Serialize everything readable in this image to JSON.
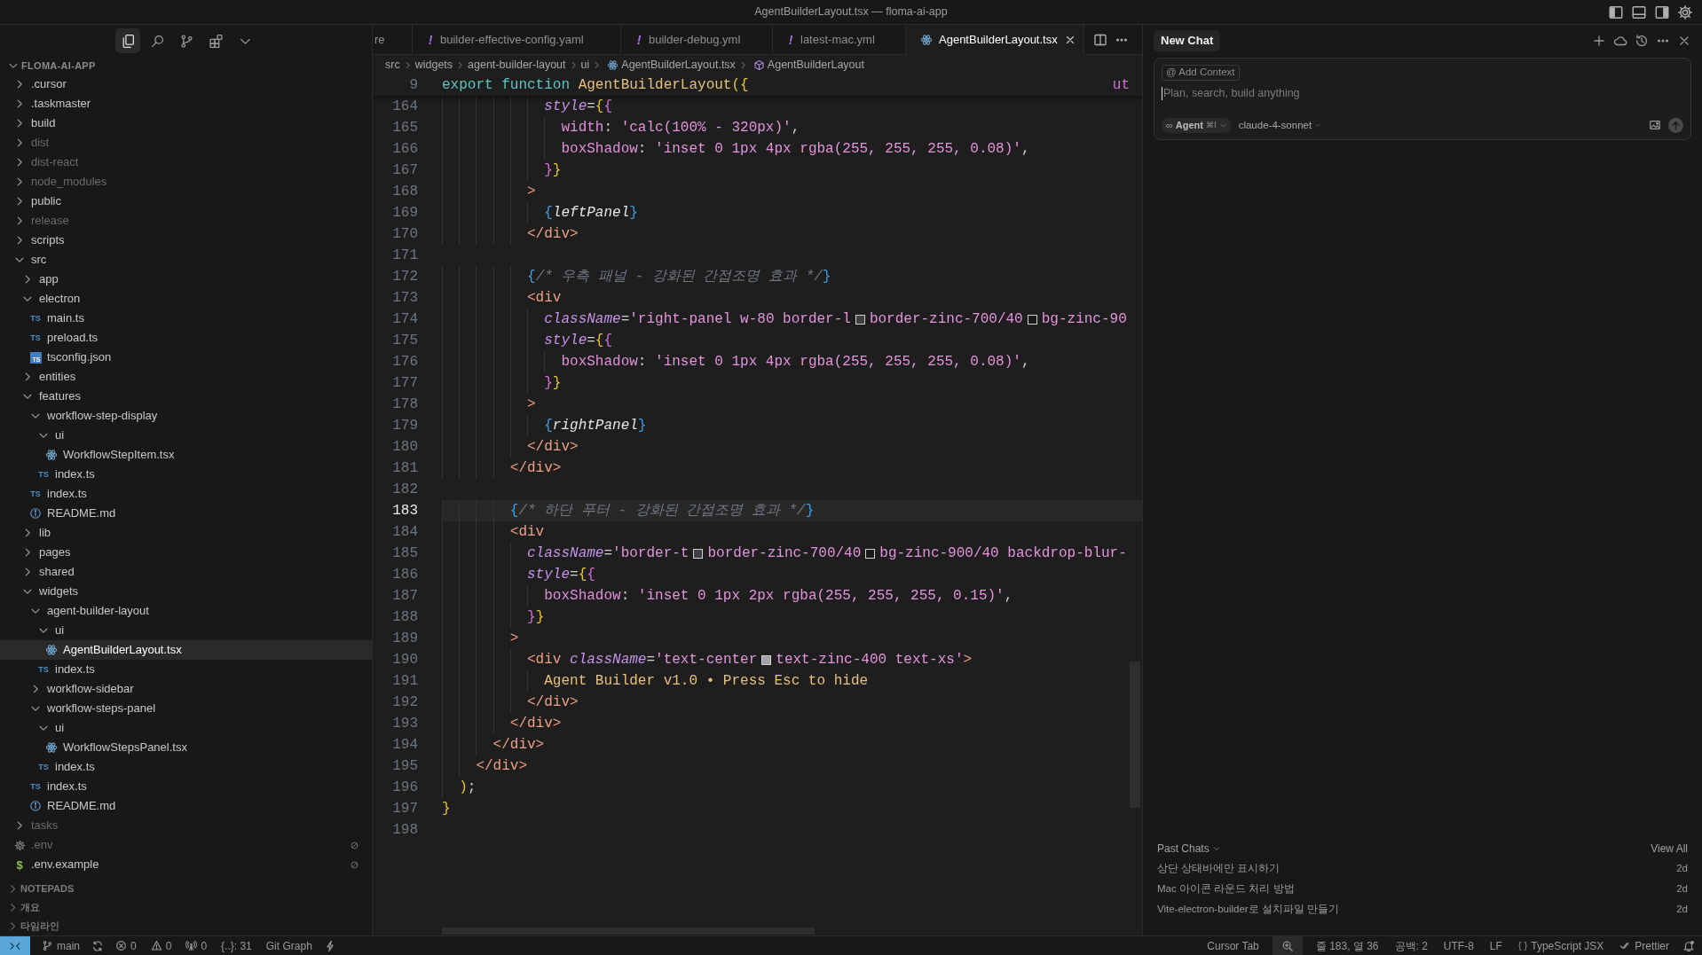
{
  "window": {
    "title": "AgentBuilderLayout.tsx — floma-ai-app"
  },
  "title_bar_icons": [
    {
      "kind": "layout-left"
    },
    {
      "kind": "layout-bottom"
    },
    {
      "kind": "layout-right"
    },
    {
      "kind": "settings"
    }
  ],
  "activity_bar": [
    {
      "kind": "files",
      "selected": true
    },
    {
      "kind": "search",
      "selected": false
    },
    {
      "kind": "source-control",
      "selected": false
    },
    {
      "kind": "extensions",
      "selected": false
    },
    {
      "kind": "more",
      "selected": false
    }
  ],
  "explorer": {
    "title": "FLOMA-AI-APP",
    "expanded": true,
    "items": [
      {
        "label": ".cursor",
        "kind": "folder",
        "expanded": false,
        "ignored": false,
        "excluded": false,
        "selected": false
      },
      {
        "label": ".taskmaster",
        "kind": "folder",
        "expanded": false,
        "ignored": false,
        "excluded": false,
        "selected": false
      },
      {
        "label": "build",
        "kind": "folder",
        "expanded": false,
        "ignored": false,
        "excluded": false,
        "selected": false
      },
      {
        "label": "dist",
        "kind": "folder",
        "expanded": false,
        "ignored": true,
        "excluded": false,
        "selected": false
      },
      {
        "label": "dist-react",
        "kind": "folder",
        "expanded": false,
        "ignored": true,
        "excluded": false,
        "selected": false
      },
      {
        "label": "node_modules",
        "kind": "folder",
        "expanded": false,
        "ignored": true,
        "excluded": false,
        "selected": false
      },
      {
        "label": "public",
        "kind": "folder",
        "expanded": false,
        "ignored": false,
        "excluded": false,
        "selected": false
      },
      {
        "label": "release",
        "kind": "folder",
        "expanded": false,
        "ignored": true,
        "excluded": false,
        "selected": false
      },
      {
        "label": "scripts",
        "kind": "folder",
        "expanded": false,
        "ignored": false,
        "excluded": false,
        "selected": false
      },
      {
        "label": "src",
        "kind": "folder",
        "expanded": true,
        "ignored": false,
        "excluded": false,
        "selected": false,
        "children": [
          {
            "label": "app",
            "kind": "folder",
            "expanded": false,
            "ignored": false,
            "excluded": false,
            "selected": false
          },
          {
            "label": "electron",
            "kind": "folder",
            "expanded": true,
            "ignored": false,
            "excluded": false,
            "selected": false,
            "children": [
              {
                "label": "main.ts",
                "kind": "ts",
                "icon_text": "TS",
                "ignored": false,
                "excluded": false,
                "selected": false
              },
              {
                "label": "preload.ts",
                "kind": "ts",
                "icon_text": "TS",
                "ignored": false,
                "excluded": false,
                "selected": false
              },
              {
                "label": "tsconfig.json",
                "kind": "tsconfig",
                "icon_text": "TS",
                "ignored": false,
                "excluded": false,
                "selected": false
              }
            ]
          },
          {
            "label": "entities",
            "kind": "folder",
            "expanded": false,
            "ignored": false,
            "excluded": false,
            "selected": false
          },
          {
            "label": "features",
            "kind": "folder",
            "expanded": true,
            "ignored": false,
            "excluded": false,
            "selected": false,
            "children": [
              {
                "label": "workflow-step-display",
                "kind": "folder",
                "expanded": true,
                "ignored": false,
                "excluded": false,
                "selected": false,
                "children": [
                  {
                    "label": "ui",
                    "kind": "folder",
                    "expanded": true,
                    "ignored": false,
                    "excluded": false,
                    "selected": false,
                    "children": [
                      {
                        "label": "WorkflowStepItem.tsx",
                        "kind": "react",
                        "ignored": false,
                        "excluded": false,
                        "selected": false
                      }
                    ]
                  },
                  {
                    "label": "index.ts",
                    "kind": "ts",
                    "icon_text": "TS",
                    "ignored": false,
                    "excluded": false,
                    "selected": false
                  }
                ]
              },
              {
                "label": "index.ts",
                "kind": "ts",
                "icon_text": "TS",
                "ignored": false,
                "excluded": false,
                "selected": false
              },
              {
                "label": "README.md",
                "kind": "info",
                "ignored": false,
                "excluded": false,
                "selected": false
              }
            ]
          },
          {
            "label": "lib",
            "kind": "folder",
            "expanded": false,
            "ignored": false,
            "excluded": false,
            "selected": false
          },
          {
            "label": "pages",
            "kind": "folder",
            "expanded": false,
            "ignored": false,
            "excluded": false,
            "selected": false
          },
          {
            "label": "shared",
            "kind": "folder",
            "expanded": false,
            "ignored": false,
            "excluded": false,
            "selected": false
          },
          {
            "label": "widgets",
            "kind": "folder",
            "expanded": true,
            "ignored": false,
            "excluded": false,
            "selected": false,
            "children": [
              {
                "label": "agent-builder-layout",
                "kind": "folder",
                "expanded": true,
                "ignored": false,
                "excluded": false,
                "selected": false,
                "children": [
                  {
                    "label": "ui",
                    "kind": "folder",
                    "expanded": true,
                    "ignored": false,
                    "excluded": false,
                    "selected": false,
                    "children": [
                      {
                        "label": "AgentBuilderLayout.tsx",
                        "kind": "react",
                        "ignored": false,
                        "excluded": false,
                        "selected": true
                      }
                    ]
                  },
                  {
                    "label": "index.ts",
                    "kind": "ts",
                    "icon_text": "TS",
                    "ignored": false,
                    "excluded": false,
                    "selected": false
                  }
                ]
              },
              {
                "label": "workflow-sidebar",
                "kind": "folder",
                "expanded": false,
                "ignored": false,
                "excluded": false,
                "selected": false
              },
              {
                "label": "workflow-steps-panel",
                "kind": "folder",
                "expanded": true,
                "ignored": false,
                "excluded": false,
                "selected": false,
                "children": [
                  {
                    "label": "ui",
                    "kind": "folder",
                    "expanded": true,
                    "ignored": false,
                    "excluded": false,
                    "selected": false,
                    "children": [
                      {
                        "label": "WorkflowStepsPanel.tsx",
                        "kind": "react",
                        "ignored": false,
                        "excluded": false,
                        "selected": false
                      }
                    ]
                  },
                  {
                    "label": "index.ts",
                    "kind": "ts",
                    "icon_text": "TS",
                    "ignored": false,
                    "excluded": false,
                    "selected": false
                  }
                ]
              },
              {
                "label": "index.ts",
                "kind": "ts",
                "icon_text": "TS",
                "ignored": false,
                "excluded": false,
                "selected": false
              },
              {
                "label": "README.md",
                "kind": "info",
                "ignored": false,
                "excluded": false,
                "selected": false
              }
            ]
          }
        ]
      },
      {
        "label": "tasks",
        "kind": "folder",
        "expanded": false,
        "ignored": true,
        "excluded": false,
        "selected": false
      },
      {
        "label": ".env",
        "kind": "gear",
        "ignored": true,
        "excluded": true,
        "selected": false
      },
      {
        "label": ".env.example",
        "kind": "dollar",
        "icon_text": "$",
        "ignored": false,
        "excluded": true,
        "selected": false
      }
    ]
  },
  "sidebar_sections": [
    {
      "title": "NOTEPADS",
      "expanded": false
    },
    {
      "title": "개요",
      "expanded": false
    },
    {
      "title": "타임라인",
      "expanded": false
    }
  ],
  "tabs": [
    {
      "label": "re",
      "kind": "plain",
      "selected": false
    },
    {
      "label": "builder-effective-config.yaml",
      "kind": "yaml",
      "icon_text": "!",
      "selected": false
    },
    {
      "label": "builder-debug.yml",
      "kind": "yaml",
      "icon_text": "!",
      "selected": false
    },
    {
      "label": "latest-mac.yml",
      "kind": "yaml",
      "icon_text": "!",
      "selected": false
    },
    {
      "label": "AgentBuilderLayout.tsx",
      "kind": "react",
      "selected": true
    }
  ],
  "breadcrumbs": [
    {
      "label": "src",
      "kind": "plain"
    },
    {
      "label": "widgets",
      "kind": "plain"
    },
    {
      "label": "agent-builder-layout",
      "kind": "plain"
    },
    {
      "label": "ui",
      "kind": "plain"
    },
    {
      "label": "AgentBuilderLayout.tsx",
      "kind": "react"
    },
    {
      "label": "AgentBuilderLayout",
      "kind": "component"
    }
  ],
  "editor": {
    "sticky_line": {
      "number": "9",
      "tokens": [
        {
          "kind": "kw",
          "text": "export function "
        },
        {
          "kind": "fn",
          "text": "AgentBuilderLayout"
        },
        {
          "kind": "br1",
          "text": "({"
        }
      ]
    },
    "sticky_overflow": "ut",
    "lines": [
      {
        "number": "164",
        "current": false,
        "tokens": [
          {
            "kind": "attr",
            "text": "            style"
          },
          {
            "kind": "op",
            "text": "="
          },
          {
            "kind": "br1",
            "text": "{"
          },
          {
            "kind": "br2",
            "text": "{"
          }
        ]
      },
      {
        "number": "165",
        "current": false,
        "tokens": [
          {
            "kind": "prop",
            "text": "              width"
          },
          {
            "kind": "op",
            "text": ": "
          },
          {
            "kind": "str",
            "text": "'calc(100% - 320px)'"
          },
          {
            "kind": "op",
            "text": ","
          }
        ]
      },
      {
        "number": "166",
        "current": false,
        "tokens": [
          {
            "kind": "prop",
            "text": "              boxShadow"
          },
          {
            "kind": "op",
            "text": ": "
          },
          {
            "kind": "str",
            "text": "'inset 0 1px 4px rgba(255, 255, 255, 0.08)'"
          },
          {
            "kind": "op",
            "text": ","
          }
        ]
      },
      {
        "number": "167",
        "current": false,
        "tokens": [
          {
            "kind": "br2",
            "text": "            }"
          },
          {
            "kind": "br1",
            "text": "}"
          }
        ]
      },
      {
        "number": "168",
        "current": false,
        "tokens": [
          {
            "kind": "tag",
            "text": "          >"
          }
        ]
      },
      {
        "number": "169",
        "current": false,
        "tokens": [
          {
            "kind": "br3",
            "text": "            {"
          },
          {
            "kind": "ident",
            "text": "leftPanel"
          },
          {
            "kind": "br3",
            "text": "}"
          }
        ]
      },
      {
        "number": "170",
        "current": false,
        "tokens": [
          {
            "kind": "tag",
            "text": "          </div>"
          }
        ]
      },
      {
        "number": "171",
        "current": false
      },
      {
        "number": "172",
        "current": false,
        "tokens": [
          {
            "kind": "br3",
            "text": "          {"
          },
          {
            "kind": "cmt",
            "text": "/* 우측 패널 - 강화된 간접조명 효과 */"
          },
          {
            "kind": "br3",
            "text": "}"
          }
        ]
      },
      {
        "number": "173",
        "current": false,
        "tokens": [
          {
            "kind": "tag",
            "text": "          <div"
          }
        ]
      },
      {
        "number": "174",
        "current": false,
        "tokens": [
          {
            "kind": "attr",
            "text": "            className"
          },
          {
            "kind": "op",
            "text": "="
          },
          {
            "kind": "str",
            "text": "'right-panel w-80 border-l"
          },
          {
            "kind": "swatch",
            "color": "#3f3f46"
          },
          {
            "kind": "str",
            "text": "border-zinc-700/40"
          },
          {
            "kind": "swatch",
            "color": "#18181b"
          },
          {
            "kind": "str",
            "text": "bg-zinc-90"
          }
        ]
      },
      {
        "number": "175",
        "current": false,
        "tokens": [
          {
            "kind": "attr",
            "text": "            style"
          },
          {
            "kind": "op",
            "text": "="
          },
          {
            "kind": "br1",
            "text": "{"
          },
          {
            "kind": "br2",
            "text": "{"
          }
        ]
      },
      {
        "number": "176",
        "current": false,
        "tokens": [
          {
            "kind": "prop",
            "text": "              boxShadow"
          },
          {
            "kind": "op",
            "text": ": "
          },
          {
            "kind": "str",
            "text": "'inset 0 1px 4px rgba(255, 255, 255, 0.08)'"
          },
          {
            "kind": "op",
            "text": ","
          }
        ]
      },
      {
        "number": "177",
        "current": false,
        "tokens": [
          {
            "kind": "br2",
            "text": "            }"
          },
          {
            "kind": "br1",
            "text": "}"
          }
        ]
      },
      {
        "number": "178",
        "current": false,
        "tokens": [
          {
            "kind": "tag",
            "text": "          >"
          }
        ]
      },
      {
        "number": "179",
        "current": false,
        "tokens": [
          {
            "kind": "br3",
            "text": "            {"
          },
          {
            "kind": "ident",
            "text": "rightPanel"
          },
          {
            "kind": "br3",
            "text": "}"
          }
        ]
      },
      {
        "number": "180",
        "current": false,
        "tokens": [
          {
            "kind": "tag",
            "text": "          </div>"
          }
        ]
      },
      {
        "number": "181",
        "current": false,
        "tokens": [
          {
            "kind": "tag",
            "text": "        </div>"
          }
        ]
      },
      {
        "number": "182",
        "current": false
      },
      {
        "number": "183",
        "current": true,
        "tokens": [
          {
            "kind": "br3",
            "text": "        {"
          },
          {
            "kind": "cmt",
            "text": "/* 하단 푸터 - 강화된 간접조명 효과 */"
          },
          {
            "kind": "br3",
            "text": "}"
          }
        ]
      },
      {
        "number": "184",
        "current": false,
        "tokens": [
          {
            "kind": "tag",
            "text": "        <div"
          }
        ]
      },
      {
        "number": "185",
        "current": false,
        "tokens": [
          {
            "kind": "attr",
            "text": "          className"
          },
          {
            "kind": "op",
            "text": "="
          },
          {
            "kind": "str",
            "text": "'border-t"
          },
          {
            "kind": "swatch",
            "color": "#3f3f46"
          },
          {
            "kind": "str",
            "text": "border-zinc-700/40"
          },
          {
            "kind": "swatch",
            "color": "#18181b"
          },
          {
            "kind": "str",
            "text": "bg-zinc-900/40 backdrop-blur-"
          }
        ]
      },
      {
        "number": "186",
        "current": false,
        "tokens": [
          {
            "kind": "attr",
            "text": "          style"
          },
          {
            "kind": "op",
            "text": "="
          },
          {
            "kind": "br1",
            "text": "{"
          },
          {
            "kind": "br2",
            "text": "{"
          }
        ]
      },
      {
        "number": "187",
        "current": false,
        "tokens": [
          {
            "kind": "prop",
            "text": "            boxShadow"
          },
          {
            "kind": "op",
            "text": ": "
          },
          {
            "kind": "str",
            "text": "'inset 0 1px 2px rgba(255, 255, 255, 0.15)'"
          },
          {
            "kind": "op",
            "text": ","
          }
        ]
      },
      {
        "number": "188",
        "current": false,
        "tokens": [
          {
            "kind": "br2",
            "text": "          }"
          },
          {
            "kind": "br1",
            "text": "}"
          }
        ]
      },
      {
        "number": "189",
        "current": false,
        "tokens": [
          {
            "kind": "tag",
            "text": "        >"
          }
        ]
      },
      {
        "number": "190",
        "current": false,
        "tokens": [
          {
            "kind": "tag",
            "text": "          <div "
          },
          {
            "kind": "attr",
            "text": "className"
          },
          {
            "kind": "op",
            "text": "="
          },
          {
            "kind": "str",
            "text": "'text-center"
          },
          {
            "kind": "swatch",
            "color": "#a1a1aa"
          },
          {
            "kind": "str",
            "text": "text-zinc-400 text-xs'"
          },
          {
            "kind": "tag",
            "text": ">"
          }
        ]
      },
      {
        "number": "191",
        "current": false,
        "tokens": [
          {
            "kind": "jsx",
            "text": "            Agent Builder v1.0 • Press Esc to hide"
          }
        ]
      },
      {
        "number": "192",
        "current": false,
        "tokens": [
          {
            "kind": "tag",
            "text": "          </div>"
          }
        ]
      },
      {
        "number": "193",
        "current": false,
        "tokens": [
          {
            "kind": "tag",
            "text": "        </div>"
          }
        ]
      },
      {
        "number": "194",
        "current": false,
        "tokens": [
          {
            "kind": "tag",
            "text": "      </div>"
          }
        ]
      },
      {
        "number": "195",
        "current": false,
        "tokens": [
          {
            "kind": "tag",
            "text": "    </div>"
          }
        ]
      },
      {
        "number": "196",
        "current": false,
        "tokens": [
          {
            "kind": "br1",
            "text": "  )"
          },
          {
            "kind": "op",
            "text": ";"
          }
        ]
      },
      {
        "number": "197",
        "current": false,
        "tokens": [
          {
            "kind": "br1",
            "text": "}"
          }
        ]
      },
      {
        "number": "198",
        "current": false
      }
    ]
  },
  "chat": {
    "tab": "New Chat",
    "add_context": {
      "glyph": "@",
      "label": "Add Context"
    },
    "placeholder": "Plan, search, build anything",
    "mode": {
      "glyph": "∞",
      "label": "Agent",
      "shortcut": "⌘I"
    },
    "model": "claude-4-sonnet",
    "past_chats": {
      "title": "Past Chats",
      "view_all": "View All",
      "items": [
        {
          "title": "상단 상태바에만 표시하기",
          "age": "2d"
        },
        {
          "title": "Mac 아이콘 라운드 처리 방법",
          "age": "2d"
        },
        {
          "title": "Vite-electron-builder로 설치파일 만들기",
          "age": "2d"
        }
      ]
    }
  },
  "status_bar": {
    "left": [
      {
        "kind": "remote"
      },
      {
        "kind": "branch",
        "text": "main"
      },
      {
        "kind": "sync"
      },
      {
        "kind": "errors",
        "text": "0"
      },
      {
        "kind": "warnings",
        "text": "0"
      },
      {
        "kind": "ports",
        "text": "0"
      },
      {
        "kind": "plain",
        "text": "{..}: 31"
      },
      {
        "kind": "plain",
        "text": "Git Graph"
      },
      {
        "kind": "bolt"
      }
    ],
    "right": [
      {
        "kind": "plain",
        "text": "Cursor Tab"
      },
      {
        "kind": "zoom"
      },
      {
        "kind": "plain",
        "text": "줄 183, 열 36"
      },
      {
        "kind": "plain",
        "text": "공백: 2"
      },
      {
        "kind": "plain",
        "text": "UTF-8"
      },
      {
        "kind": "plain",
        "text": "LF"
      },
      {
        "kind": "language",
        "glyph": "{ }",
        "text": "TypeScript JSX"
      },
      {
        "kind": "prettier",
        "text": "Prettier"
      },
      {
        "kind": "bell"
      }
    ]
  }
}
